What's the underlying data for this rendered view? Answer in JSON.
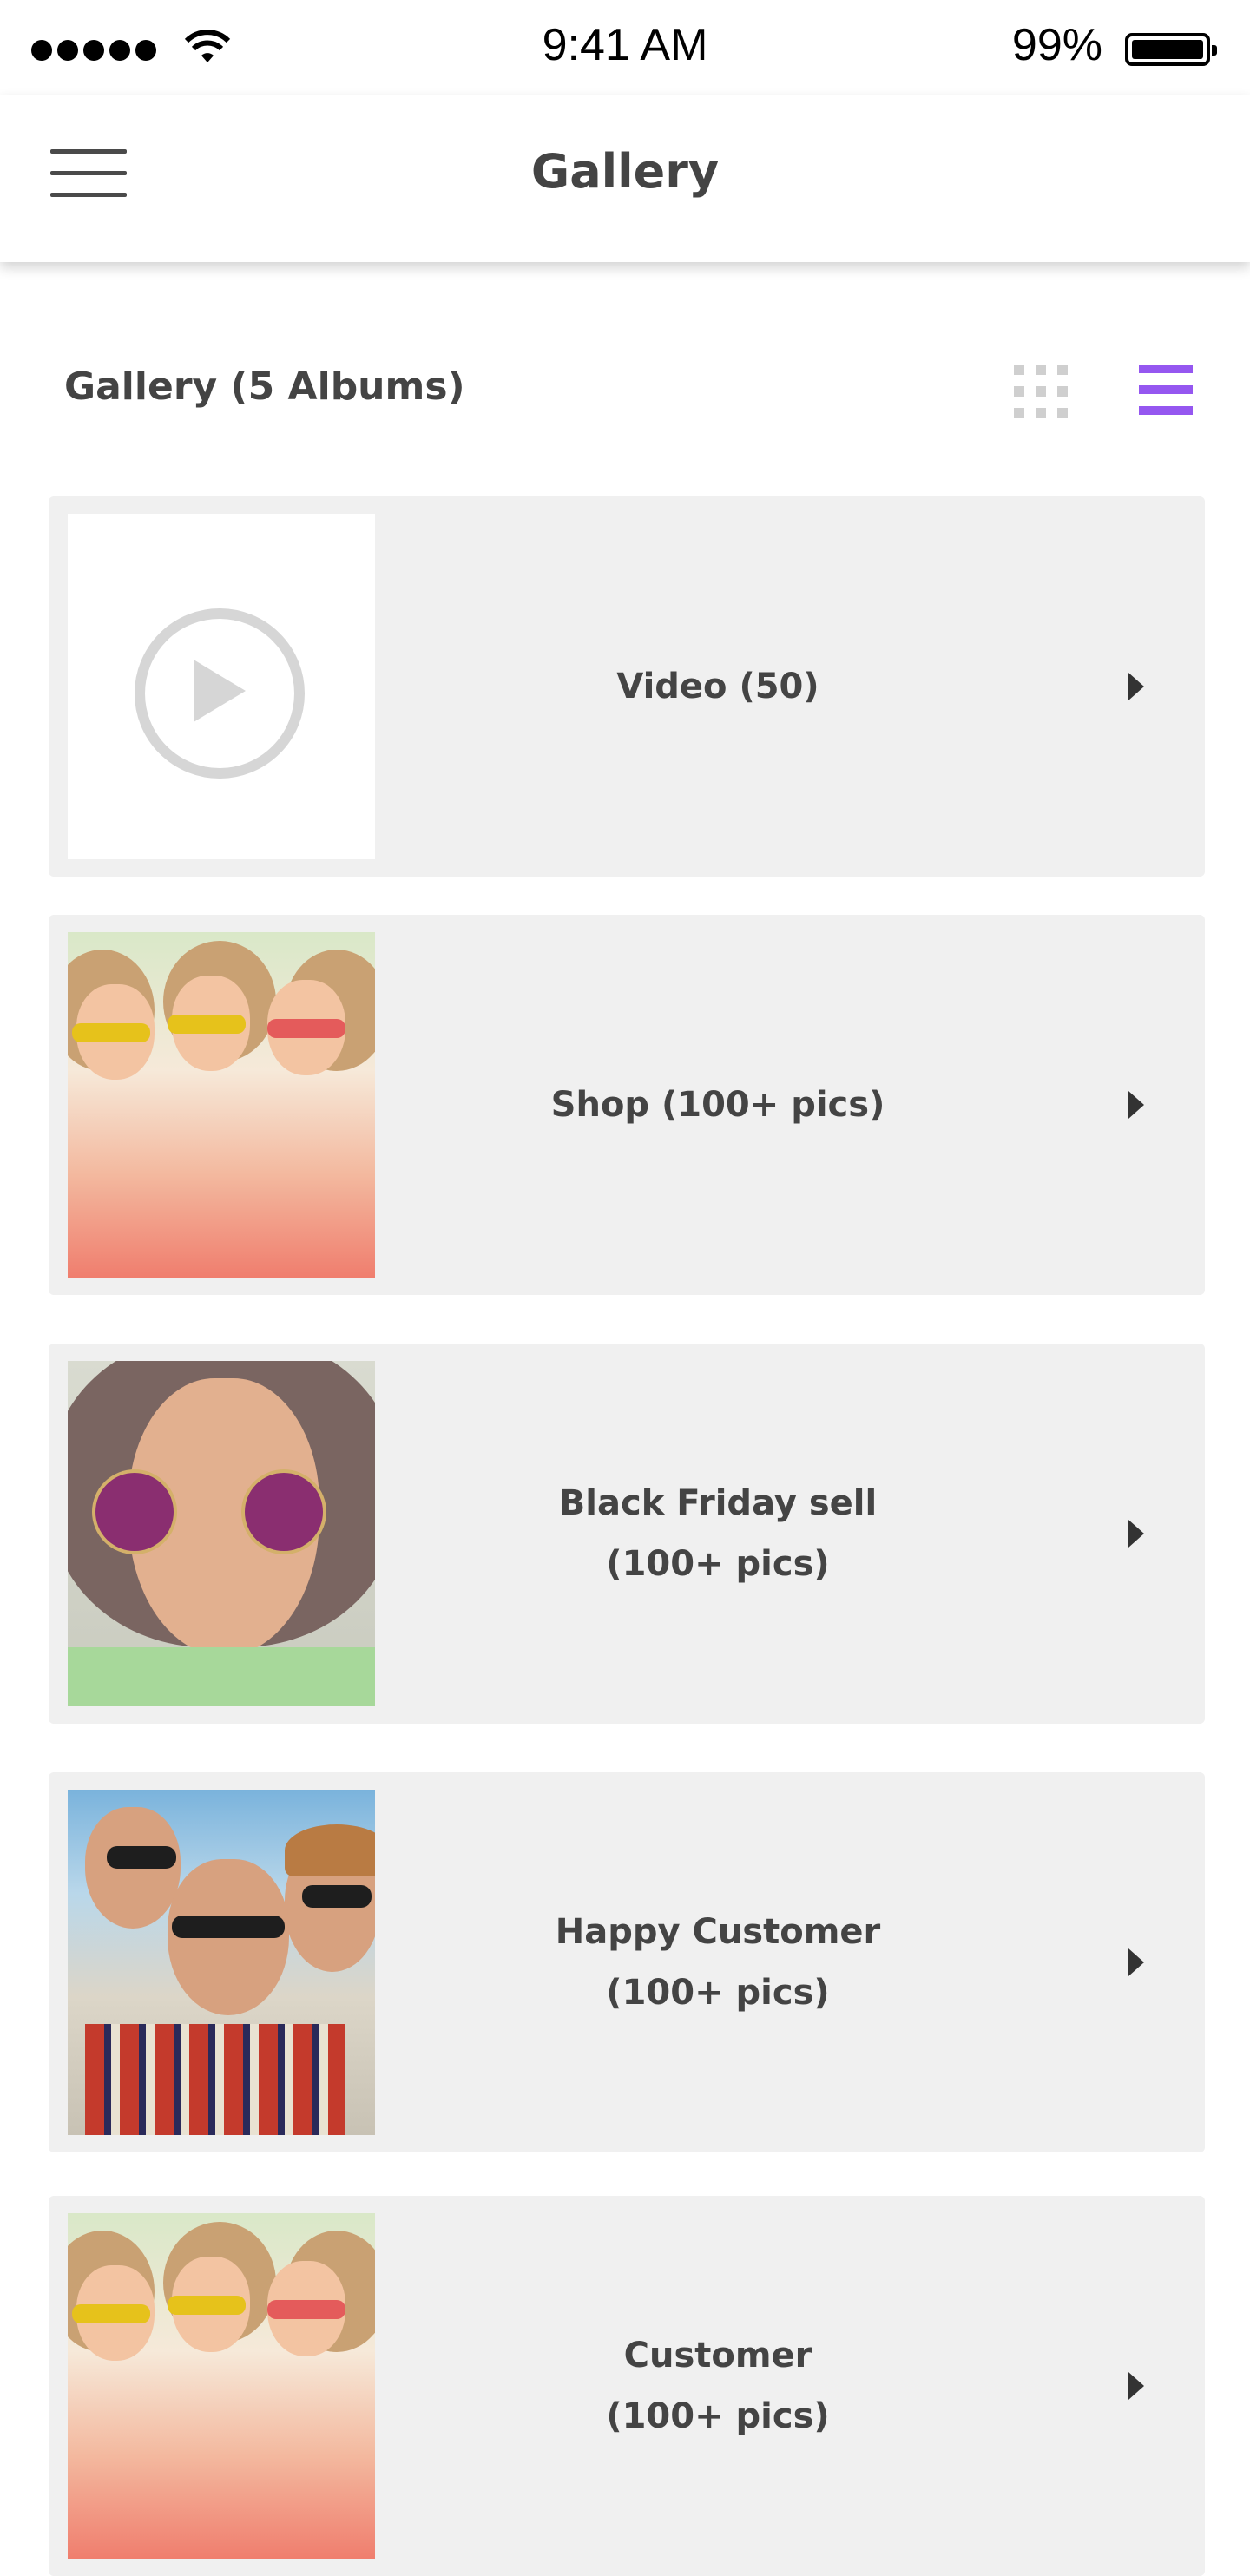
{
  "status_bar": {
    "time": "9:41 AM",
    "battery_percent": "99%",
    "signal_icon": "signal-dots-icon",
    "wifi_icon": "wifi-icon",
    "battery_icon": "battery-icon"
  },
  "nav": {
    "title": "Gallery",
    "menu_icon": "hamburger-menu-icon"
  },
  "gallery": {
    "header": "Gallery (5 Albums)",
    "view_options": {
      "grid_icon": "grid-view-icon",
      "list_icon": "list-view-icon",
      "selected": "list"
    },
    "accent_color": "#9557f0",
    "albums": [
      {
        "label": "Video (50)",
        "thumbnail": "play-icon"
      },
      {
        "label": "Shop (100+ pics)",
        "thumbnail": "photo-friends-sunglasses"
      },
      {
        "label": "Black Friday sell\n(100+ pics)",
        "thumbnail": "photo-portrait-sunglasses"
      },
      {
        "label": "Happy Customer\n(100+ pics)",
        "thumbnail": "photo-group-selfie"
      },
      {
        "label": "Customer\n(100+ pics)",
        "thumbnail": "photo-friends-sunglasses"
      }
    ]
  }
}
